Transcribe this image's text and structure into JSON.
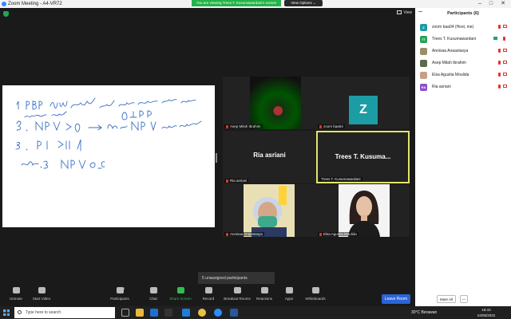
{
  "window": {
    "title": "Zoom Meeting - A4-VR72",
    "minimize": "–",
    "maximize": "□",
    "close": "✕"
  },
  "banner": {
    "text": "You are viewing Trees T. Kusumawardani's screen",
    "view_options": "View Options ⌄"
  },
  "meeting": {
    "view_label": "View"
  },
  "tiles": [
    {
      "name": "Asep Milah Ibrahim"
    },
    {
      "name": "zoom baa04",
      "initial": "Z"
    },
    {
      "name": "Ria asriani",
      "display": "Ria asriani"
    },
    {
      "name": "Trees T. Kusumawardani",
      "display": "Trees T. Kusuma..."
    },
    {
      "name": "Annisaa Anaastasya"
    },
    {
      "name": "Elsa Agustia Moulida"
    }
  ],
  "unassigned": "5 unassigned participants",
  "toolbar": {
    "unmute": "Unmute",
    "start_video": "Start Video",
    "participants": "Participants",
    "participants_count": "6",
    "chat": "Chat",
    "share_screen": "Share Screen",
    "record": "Record",
    "breakout_rooms": "Breakout Rooms",
    "reactions": "Reactions",
    "apps": "Apps",
    "whiteboards": "Whiteboards",
    "leave": "Leave Room"
  },
  "panel": {
    "title": "Participants (6)",
    "items": [
      {
        "name": "zoom baa04 (Host, me)",
        "initials": "Z",
        "color": "#1c9ca4",
        "video": "off"
      },
      {
        "name": "Trees T. Kusumawardani",
        "initials": "TT",
        "color": "#23a455",
        "video": "on"
      },
      {
        "name": "Annisaa Anaastasya",
        "initials": "",
        "color": "#9b8f6a",
        "video": "off"
      },
      {
        "name": "Asep Milah Ibrahim",
        "initials": "",
        "color": "#5a6a4a",
        "video": "off"
      },
      {
        "name": "Elsa Agustia Moulida",
        "initials": "",
        "color": "#c8a08a",
        "video": "off"
      },
      {
        "name": "Ria asriani",
        "initials": "RA",
        "color": "#8a4ec8",
        "video": "off"
      }
    ],
    "mute_all": "Mute All",
    "more": "..."
  },
  "taskbar": {
    "search_placeholder": "Type here to search",
    "weather": "30°C  Berawan",
    "time": "18:43",
    "date": "24/05/2022"
  }
}
